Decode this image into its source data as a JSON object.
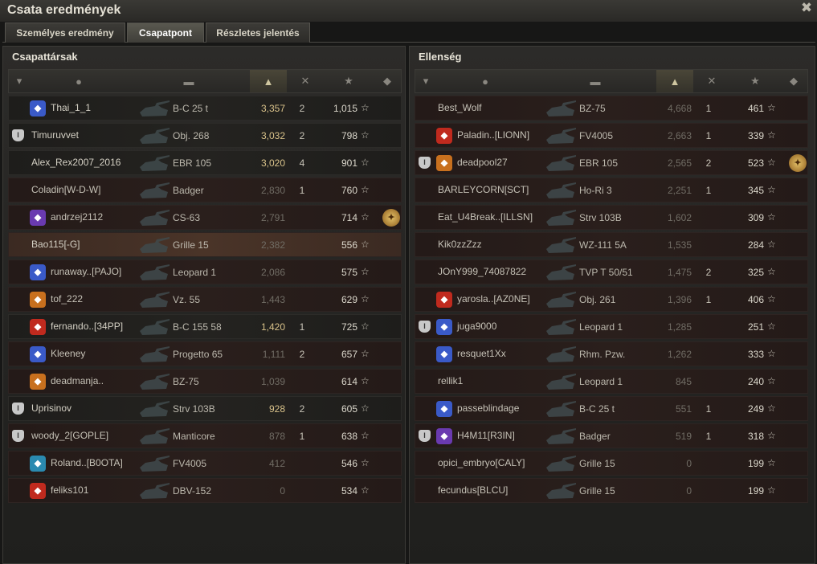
{
  "window": {
    "title": "Csata eredmények",
    "close_icon": "close-icon"
  },
  "tabs": [
    {
      "label": "Személyes eredmény",
      "active": false
    },
    {
      "label": "Csapatpont",
      "active": true
    },
    {
      "label": "Részletes jelentés",
      "active": false
    }
  ],
  "columns": [
    "platoon-icon",
    "player-icon",
    "tank-icon",
    "damage-icon",
    "kills-icon",
    "star-icon",
    "medal-icon"
  ],
  "allies": {
    "title": "Csapattársak",
    "rows": [
      {
        "name": "Thai_1_1",
        "vehicle": "B-C 25 t",
        "damage": "3,357",
        "kills": "2",
        "xp": "1,015",
        "platoon": false,
        "badge": "blue",
        "medal": false,
        "state": "alive",
        "gold": true
      },
      {
        "name": "Timuruvvet",
        "vehicle": "Obj. 268",
        "damage": "3,032",
        "kills": "2",
        "xp": "798",
        "platoon": true,
        "badge": "",
        "medal": false,
        "state": "alive",
        "gold": true
      },
      {
        "name": "Alex_Rex2007_2016",
        "vehicle": "EBR 105",
        "damage": "3,020",
        "kills": "4",
        "xp": "901",
        "platoon": false,
        "badge": "",
        "medal": false,
        "state": "alive",
        "gold": true
      },
      {
        "name": "Coladin[W-D-W]",
        "vehicle": "Badger",
        "damage": "2,830",
        "kills": "1",
        "xp": "760",
        "platoon": false,
        "badge": "",
        "medal": false,
        "state": "dead",
        "gold": false
      },
      {
        "name": "andrzej2112",
        "vehicle": "CS-63",
        "damage": "2,791",
        "kills": "",
        "xp": "714",
        "platoon": false,
        "badge": "purple",
        "medal": true,
        "state": "dead",
        "gold": false
      },
      {
        "name": "Bao115[-G]",
        "vehicle": "Grille 15",
        "damage": "2,382",
        "kills": "",
        "xp": "556",
        "platoon": false,
        "badge": "",
        "medal": false,
        "state": "hl",
        "gold": false
      },
      {
        "name": "runaway..[PAJO]",
        "vehicle": "Leopard 1",
        "damage": "2,086",
        "kills": "",
        "xp": "575",
        "platoon": false,
        "badge": "blue",
        "medal": false,
        "state": "dead",
        "gold": false
      },
      {
        "name": "tof_222",
        "vehicle": "Vz. 55",
        "damage": "1,443",
        "kills": "",
        "xp": "629",
        "platoon": false,
        "badge": "orange",
        "medal": false,
        "state": "dead",
        "gold": false
      },
      {
        "name": "fernando..[34PP]",
        "vehicle": "B-C 155 58",
        "damage": "1,420",
        "kills": "1",
        "xp": "725",
        "platoon": false,
        "badge": "red",
        "medal": false,
        "state": "alive",
        "gold": true
      },
      {
        "name": "Kleeney",
        "vehicle": "Progetto 65",
        "damage": "1,111",
        "kills": "2",
        "xp": "657",
        "platoon": false,
        "badge": "blue",
        "medal": false,
        "state": "dead",
        "gold": false
      },
      {
        "name": "deadmanja..",
        "vehicle": "BZ-75",
        "damage": "1,039",
        "kills": "",
        "xp": "614",
        "platoon": false,
        "badge": "orange",
        "medal": false,
        "state": "dead",
        "gold": false
      },
      {
        "name": "Uprisinov",
        "vehicle": "Strv 103B",
        "damage": "928",
        "kills": "2",
        "xp": "605",
        "platoon": true,
        "badge": "",
        "medal": false,
        "state": "alive",
        "gold": true
      },
      {
        "name": "woody_2[GOPLE]",
        "vehicle": "Manticore",
        "damage": "878",
        "kills": "1",
        "xp": "638",
        "platoon": true,
        "badge": "",
        "medal": false,
        "state": "dead",
        "gold": false
      },
      {
        "name": "Roland..[B0OTA]",
        "vehicle": "FV4005",
        "damage": "412",
        "kills": "",
        "xp": "546",
        "platoon": false,
        "badge": "cyan",
        "medal": false,
        "state": "dead",
        "gold": false
      },
      {
        "name": "feliks101",
        "vehicle": "DBV-152",
        "damage": "0",
        "kills": "",
        "xp": "534",
        "platoon": false,
        "badge": "red",
        "medal": false,
        "state": "dead",
        "gold": false
      }
    ]
  },
  "enemies": {
    "title": "Ellenség",
    "rows": [
      {
        "name": "Best_Wolf",
        "vehicle": "BZ-75",
        "damage": "4,668",
        "kills": "1",
        "xp": "461",
        "platoon": false,
        "badge": "",
        "medal": false,
        "state": "dead",
        "gold": false
      },
      {
        "name": "Paladin..[LIONN]",
        "vehicle": "FV4005",
        "damage": "2,663",
        "kills": "1",
        "xp": "339",
        "platoon": false,
        "badge": "red",
        "medal": false,
        "state": "dead",
        "gold": false
      },
      {
        "name": "deadpool27",
        "vehicle": "EBR 105",
        "damage": "2,565",
        "kills": "2",
        "xp": "523",
        "platoon": true,
        "badge": "orange",
        "medal": true,
        "state": "dead",
        "gold": false
      },
      {
        "name": "BARLEYCORN[SCT]",
        "vehicle": "Ho-Ri 3",
        "damage": "2,251",
        "kills": "1",
        "xp": "345",
        "platoon": false,
        "badge": "",
        "medal": false,
        "state": "dead",
        "gold": false
      },
      {
        "name": "Eat_U4Break..[ILLSN]",
        "vehicle": "Strv 103B",
        "damage": "1,602",
        "kills": "",
        "xp": "309",
        "platoon": false,
        "badge": "",
        "medal": false,
        "state": "dead",
        "gold": false
      },
      {
        "name": "Kik0zzZzz",
        "vehicle": "WZ-111 5A",
        "damage": "1,535",
        "kills": "",
        "xp": "284",
        "platoon": false,
        "badge": "",
        "medal": false,
        "state": "dead",
        "gold": false
      },
      {
        "name": "JOnY999_74087822",
        "vehicle": "TVP T 50/51",
        "damage": "1,475",
        "kills": "2",
        "xp": "325",
        "platoon": false,
        "badge": "",
        "medal": false,
        "state": "dead",
        "gold": false
      },
      {
        "name": "yarosla..[AZ0NE]",
        "vehicle": "Obj. 261",
        "damage": "1,396",
        "kills": "1",
        "xp": "406",
        "platoon": false,
        "badge": "red",
        "medal": false,
        "state": "dead",
        "gold": false
      },
      {
        "name": "juga9000",
        "vehicle": "Leopard 1",
        "damage": "1,285",
        "kills": "",
        "xp": "251",
        "platoon": true,
        "badge": "blue",
        "medal": false,
        "state": "dead",
        "gold": false
      },
      {
        "name": "resquet1Xx",
        "vehicle": "Rhm. Pzw.",
        "damage": "1,262",
        "kills": "",
        "xp": "333",
        "platoon": false,
        "badge": "blue",
        "medal": false,
        "state": "dead",
        "gold": false
      },
      {
        "name": "rellik1",
        "vehicle": "Leopard 1",
        "damage": "845",
        "kills": "",
        "xp": "240",
        "platoon": false,
        "badge": "",
        "medal": false,
        "state": "dead",
        "gold": false
      },
      {
        "name": "passeblindage",
        "vehicle": "B-C 25 t",
        "damage": "551",
        "kills": "1",
        "xp": "249",
        "platoon": false,
        "badge": "blue",
        "medal": false,
        "state": "dead",
        "gold": false
      },
      {
        "name": "H4M11[R3IN]",
        "vehicle": "Badger",
        "damage": "519",
        "kills": "1",
        "xp": "318",
        "platoon": true,
        "badge": "purple",
        "medal": false,
        "state": "dead",
        "gold": false
      },
      {
        "name": "opici_embryo[CALY]",
        "vehicle": "Grille 15",
        "damage": "0",
        "kills": "",
        "xp": "199",
        "platoon": false,
        "badge": "",
        "medal": false,
        "state": "dead",
        "gold": false
      },
      {
        "name": "fecundus[BLCU]",
        "vehicle": "Grille 15",
        "damage": "0",
        "kills": "",
        "xp": "199",
        "platoon": false,
        "badge": "",
        "medal": false,
        "state": "dead",
        "gold": false
      }
    ]
  }
}
